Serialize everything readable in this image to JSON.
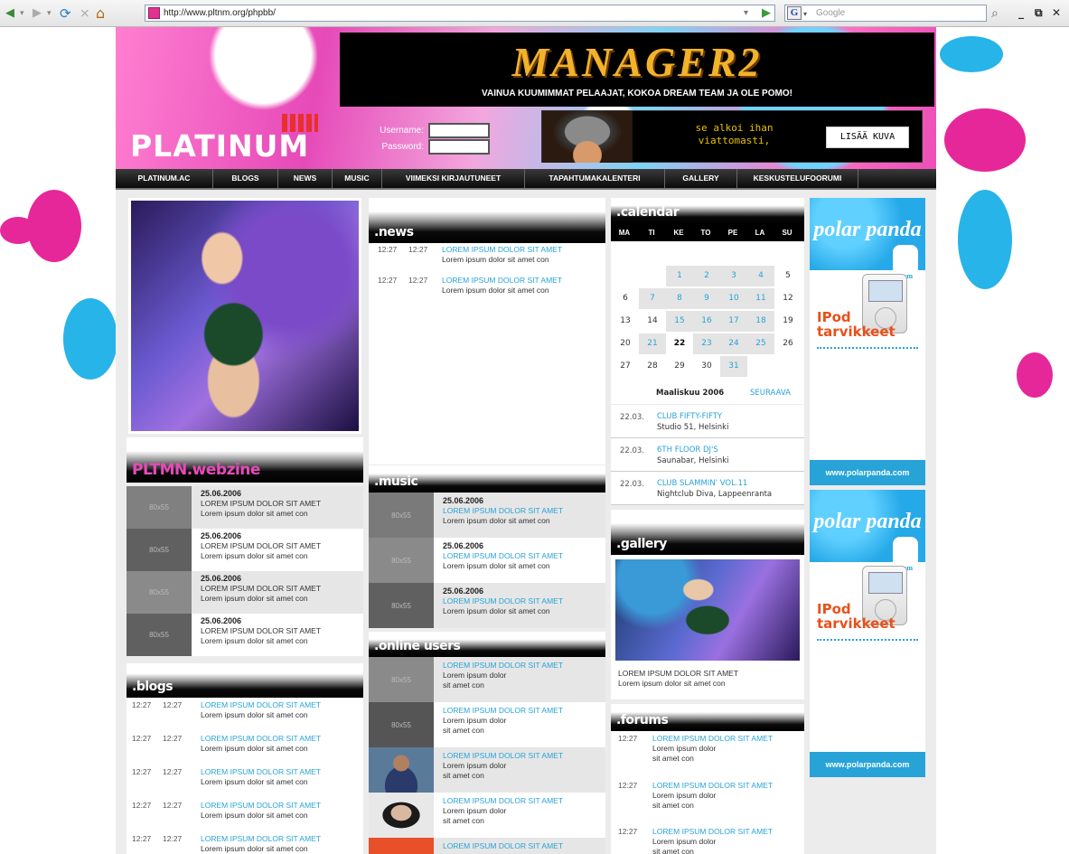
{
  "browser": {
    "url": "http://www.pltnm.org/phpbb/",
    "search_placeholder": "Google",
    "search_engine_badge": "G",
    "back_icon": "◀",
    "forward_icon": "▶",
    "refresh_icon": "⟳",
    "stop_icon": "⨯",
    "home_icon": "⌂",
    "go_icon": "▶",
    "dropdown_icon": "▾",
    "search_icon": "⌕",
    "win_min": "_",
    "win_restore": "⧉",
    "win_close": "✕"
  },
  "colors": {
    "accent_pink": "#e64ab8",
    "accent_blue": "#27a3d8",
    "nav_bg": "#0a0a0a"
  },
  "header": {
    "banner_logo": "MANAGER2",
    "banner_tagline": "VAINUA KUUMIMMAT PELAAJAT, KOKOA DREAM TEAM JA OLE POMO!",
    "site_logo": "PLATINUM",
    "username_label": "Username:",
    "password_label": "Password:",
    "ad_text": "se alkoi ihan viattomasti,",
    "ad_button": "LISÄÄ KUVA"
  },
  "nav": [
    "PLATINUM.AC",
    "BLOGS",
    "NEWS",
    "MUSIC",
    "VIIMEKSI KIRJAUTUNEET",
    "TAPAHTUMAKALENTERI",
    "GALLERY",
    "KESKUSTELUFOORUMI"
  ],
  "webzine": {
    "title": "PLTMN.webzine",
    "items": [
      {
        "thumb": "80x55",
        "date": "25.06.2006",
        "title": "LOREM IPSUM DOLOR SIT AMET",
        "body": "Lorem ipsum dolor sit amet con"
      },
      {
        "thumb": "80x55",
        "date": "25.06.2006",
        "title": "LOREM IPSUM DOLOR SIT AMET",
        "body": "Lorem ipsum dolor sit amet con"
      },
      {
        "thumb": "80x55",
        "date": "25.06.2006",
        "title": "LOREM IPSUM DOLOR SIT AMET",
        "body": "Lorem ipsum dolor sit amet con"
      },
      {
        "thumb": "80x55",
        "date": "25.06.2006",
        "title": "LOREM IPSUM DOLOR SIT AMET",
        "body": "Lorem ipsum dolor sit amet con"
      }
    ]
  },
  "blogs": {
    "title": ".blogs",
    "items": [
      {
        "t1": "12:27",
        "t2": "12:27",
        "title": "LOREM IPSUM DOLOR SIT AMET",
        "body": "Lorem ipsum dolor sit amet con"
      },
      {
        "t1": "12:27",
        "t2": "12:27",
        "title": "LOREM IPSUM DOLOR SIT AMET",
        "body": "Lorem ipsum dolor sit amet con"
      },
      {
        "t1": "12:27",
        "t2": "12:27",
        "title": "LOREM IPSUM DOLOR SIT AMET",
        "body": "Lorem ipsum dolor sit amet con"
      },
      {
        "t1": "12:27",
        "t2": "12:27",
        "title": "LOREM IPSUM DOLOR SIT AMET",
        "body": "Lorem ipsum dolor sit amet con"
      },
      {
        "t1": "12:27",
        "t2": "12:27",
        "title": "LOREM IPSUM DOLOR SIT AMET",
        "body": "Lorem ipsum dolor sit amet con"
      }
    ]
  },
  "news": {
    "title": ".news",
    "items": [
      {
        "t1": "12:27",
        "t2": "12:27",
        "title": "LOREM IPSUM DOLOR SIT AMET",
        "body": "Lorem ipsum dolor sit amet con"
      },
      {
        "t1": "12:27",
        "t2": "12:27",
        "title": "LOREM IPSUM DOLOR SIT AMET",
        "body": "Lorem ipsum dolor sit amet con"
      }
    ]
  },
  "music": {
    "title": ".music",
    "items": [
      {
        "thumb": "80x55",
        "date": "25.06.2006",
        "title": "LOREM IPSUM DOLOR SIT AMET",
        "body": "Lorem ipsum dolor sit amet con"
      },
      {
        "thumb": "80x55",
        "date": "25.06.2006",
        "title": "LOREM IPSUM DOLOR SIT AMET",
        "body": "Lorem ipsum dolor sit amet con"
      },
      {
        "thumb": "80x55",
        "date": "25.06.2006",
        "title": "LOREM IPSUM DOLOR SIT AMET",
        "body": "Lorem ipsum dolor sit amet con"
      }
    ]
  },
  "online": {
    "title": ".online users",
    "items": [
      {
        "thumb": "80x55",
        "title": "LOREM IPSUM DOLOR SIT AMET",
        "l1": "Lorem ipsum dolor",
        "l2": "sit amet con"
      },
      {
        "thumb": "80x55",
        "title": "LOREM IPSUM DOLOR SIT AMET",
        "l1": "Lorem ipsum dolor",
        "l2": "sit amet con"
      },
      {
        "thumb": "",
        "title": "LOREM IPSUM DOLOR SIT AMET",
        "l1": "Lorem ipsum dolor",
        "l2": "sit amet con"
      },
      {
        "thumb": "",
        "title": "LOREM IPSUM DOLOR SIT AMET",
        "l1": "Lorem ipsum dolor",
        "l2": "sit amet con"
      },
      {
        "thumb": "",
        "title": "LOREM IPSUM DOLOR SIT AMET",
        "l1": "",
        "l2": ""
      }
    ]
  },
  "calendar": {
    "title": ".calendar",
    "days": [
      "MA",
      "TI",
      "KE",
      "TO",
      "PE",
      "LA",
      "SU"
    ],
    "weeks": [
      [
        "",
        "",
        "",
        "",
        "",
        "",
        ""
      ],
      [
        "",
        "",
        "1",
        "2",
        "3",
        "4",
        "5"
      ],
      [
        "6",
        "7",
        "8",
        "9",
        "10",
        "11",
        "12"
      ],
      [
        "13",
        "14",
        "15",
        "16",
        "17",
        "18",
        "19"
      ],
      [
        "20",
        "21",
        "22",
        "23",
        "24",
        "25",
        "26"
      ],
      [
        "27",
        "28",
        "29",
        "30",
        "31",
        "",
        ""
      ]
    ],
    "month": "Maaliskuu 2006",
    "next": "SEURAAVA",
    "events": [
      {
        "date": "22.03.",
        "title": "CLUB FIFTY-FIFTY",
        "place": "Studio 51, Helsinki"
      },
      {
        "date": "22.03.",
        "title": "6TH FLOOR DJ'S",
        "place": "Saunabar, Helsinki"
      },
      {
        "date": "22.03.",
        "title": "CLUB SLAMMIN' VOL.11",
        "place": "Nightclub Diva, Lappeenranta"
      }
    ]
  },
  "gallery": {
    "title": ".gallery",
    "caption_title": "LOREM IPSUM DOLOR SIT AMET",
    "caption_body": "Lorem ipsum dolor sit amet con"
  },
  "forums": {
    "title": ".forums",
    "items": [
      {
        "time": "12:27",
        "title": "LOREM IPSUM DOLOR SIT AMET",
        "l1": "Lorem ipsum dolor",
        "l2": "sit amet con"
      },
      {
        "time": "12:27",
        "title": "LOREM IPSUM DOLOR SIT AMET",
        "l1": "Lorem ipsum dolor",
        "l2": "sit amet con"
      },
      {
        "time": "12:27",
        "title": "LOREM IPSUM DOLOR SIT AMET",
        "l1": "Lorem ipsum dolor",
        "l2": "sit amet con"
      }
    ]
  },
  "ads": {
    "brand": "polar panda",
    "dotcom": ".com",
    "ipod": "IPod",
    "tarvikkeet": "tarvikkeet",
    "url": "www.polarpanda.com"
  }
}
